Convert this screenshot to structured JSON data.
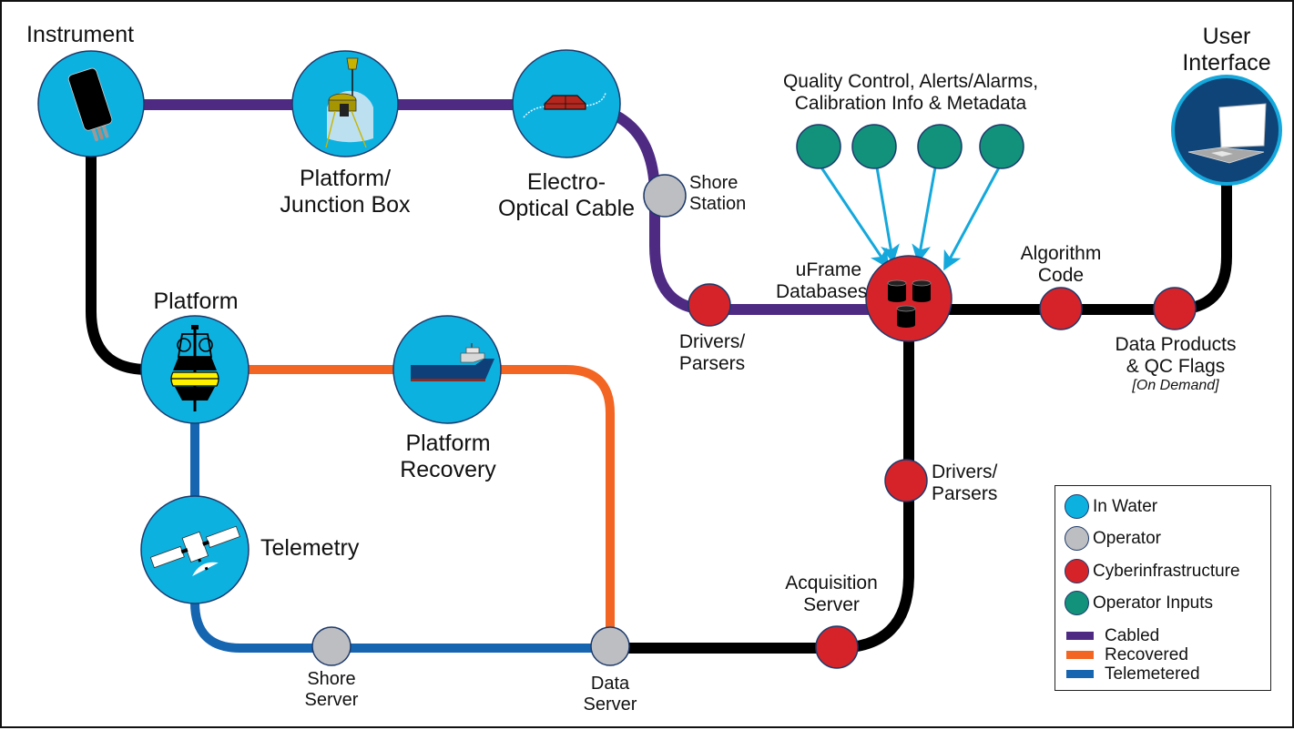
{
  "colors": {
    "in_water": "#0db1e0",
    "operator": "#bdbec1",
    "cyberinfrastructure": "#d6232a",
    "operator_inputs": "#12917b",
    "cabled": "#4e2a83",
    "recovered": "#f26522",
    "telemetered": "#1565b0",
    "trunk": "#000000",
    "arrow": "#14a8dc",
    "user_interface_fill": "#0f4478",
    "node_stroke": "#1d3a6b"
  },
  "nodes": {
    "instrument": {
      "label": "Instrument",
      "category": "In Water",
      "icon": "instrument-sensor-icon"
    },
    "junction_box": {
      "label_line1": "Platform/",
      "label_line2": "Junction Box",
      "category": "In Water",
      "icon": "junction-box-icon"
    },
    "eo_cable": {
      "label_line1": "Electro-",
      "label_line2": "Optical Cable",
      "category": "In Water",
      "icon": "cable-node-icon"
    },
    "shore_station": {
      "label_line1": "Shore",
      "label_line2": "Station",
      "category": "Operator"
    },
    "drivers_parsers_cabled": {
      "label_line1": "Drivers/",
      "label_line2": "Parsers",
      "category": "Cyberinfrastructure"
    },
    "uframe": {
      "label_line1": "uFrame",
      "label_line2": "Databases",
      "category": "Cyberinfrastructure",
      "icon": "database-icon"
    },
    "operator_inputs": {
      "label_line1": "Quality Control, Alerts/Alarms,",
      "label_line2": "Calibration Info & Metadata",
      "count": 4,
      "category": "Operator Inputs"
    },
    "algorithm_code": {
      "label_line1": "Algorithm",
      "label_line2": "Code",
      "category": "Cyberinfrastructure"
    },
    "data_products": {
      "label_line1": "Data Products",
      "label_line2": "& QC Flags",
      "note": "[On Demand]",
      "category": "Cyberinfrastructure"
    },
    "user_interface": {
      "label_line1": "User",
      "label_line2": "Interface",
      "icon": "laptop-icon"
    },
    "platform": {
      "label": "Platform",
      "category": "In Water",
      "icon": "buoy-icon"
    },
    "platform_recovery": {
      "label_line1": "Platform",
      "label_line2": "Recovery",
      "category": "In Water",
      "icon": "ship-icon"
    },
    "telemetry": {
      "label": "Telemetry",
      "category": "In Water",
      "icon": "satellite-icon"
    },
    "shore_server": {
      "label_line1": "Shore",
      "label_line2": "Server",
      "category": "Operator"
    },
    "data_server": {
      "label_line1": "Data",
      "label_line2": "Server",
      "category": "Operator"
    },
    "acquisition_server": {
      "label_line1": "Acquisition",
      "label_line2": "Server",
      "category": "Cyberinfrastructure"
    },
    "drivers_parsers_uncabled": {
      "label_line1": "Drivers/",
      "label_line2": "Parsers",
      "category": "Cyberinfrastructure"
    }
  },
  "legend": {
    "nodes": [
      {
        "label": "In Water",
        "color_key": "in_water"
      },
      {
        "label": "Operator",
        "color_key": "operator"
      },
      {
        "label": "Cyberinfrastructure",
        "color_key": "cyberinfrastructure"
      },
      {
        "label": "Operator Inputs",
        "color_key": "operator_inputs"
      }
    ],
    "lines": [
      {
        "label": "Cabled",
        "color_key": "cabled"
      },
      {
        "label": "Recovered",
        "color_key": "recovered"
      },
      {
        "label": "Telemetered",
        "color_key": "telemetered"
      }
    ]
  }
}
